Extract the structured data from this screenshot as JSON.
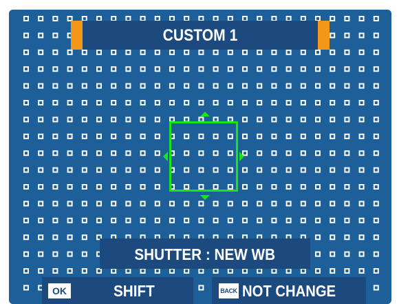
{
  "header": {
    "title": "CUSTOM 1"
  },
  "status": {
    "message": "SHUTTER : NEW WB"
  },
  "controls": {
    "ok_key": "OK",
    "ok_action": "SHIFT",
    "back_key": "BACK",
    "back_action": "NOT CHANGE"
  },
  "colors": {
    "background": "#1d5f99",
    "panel": "#1c4a7e",
    "accent": "#f39719",
    "cursor": "#19e619",
    "dot": "#ffffff"
  }
}
